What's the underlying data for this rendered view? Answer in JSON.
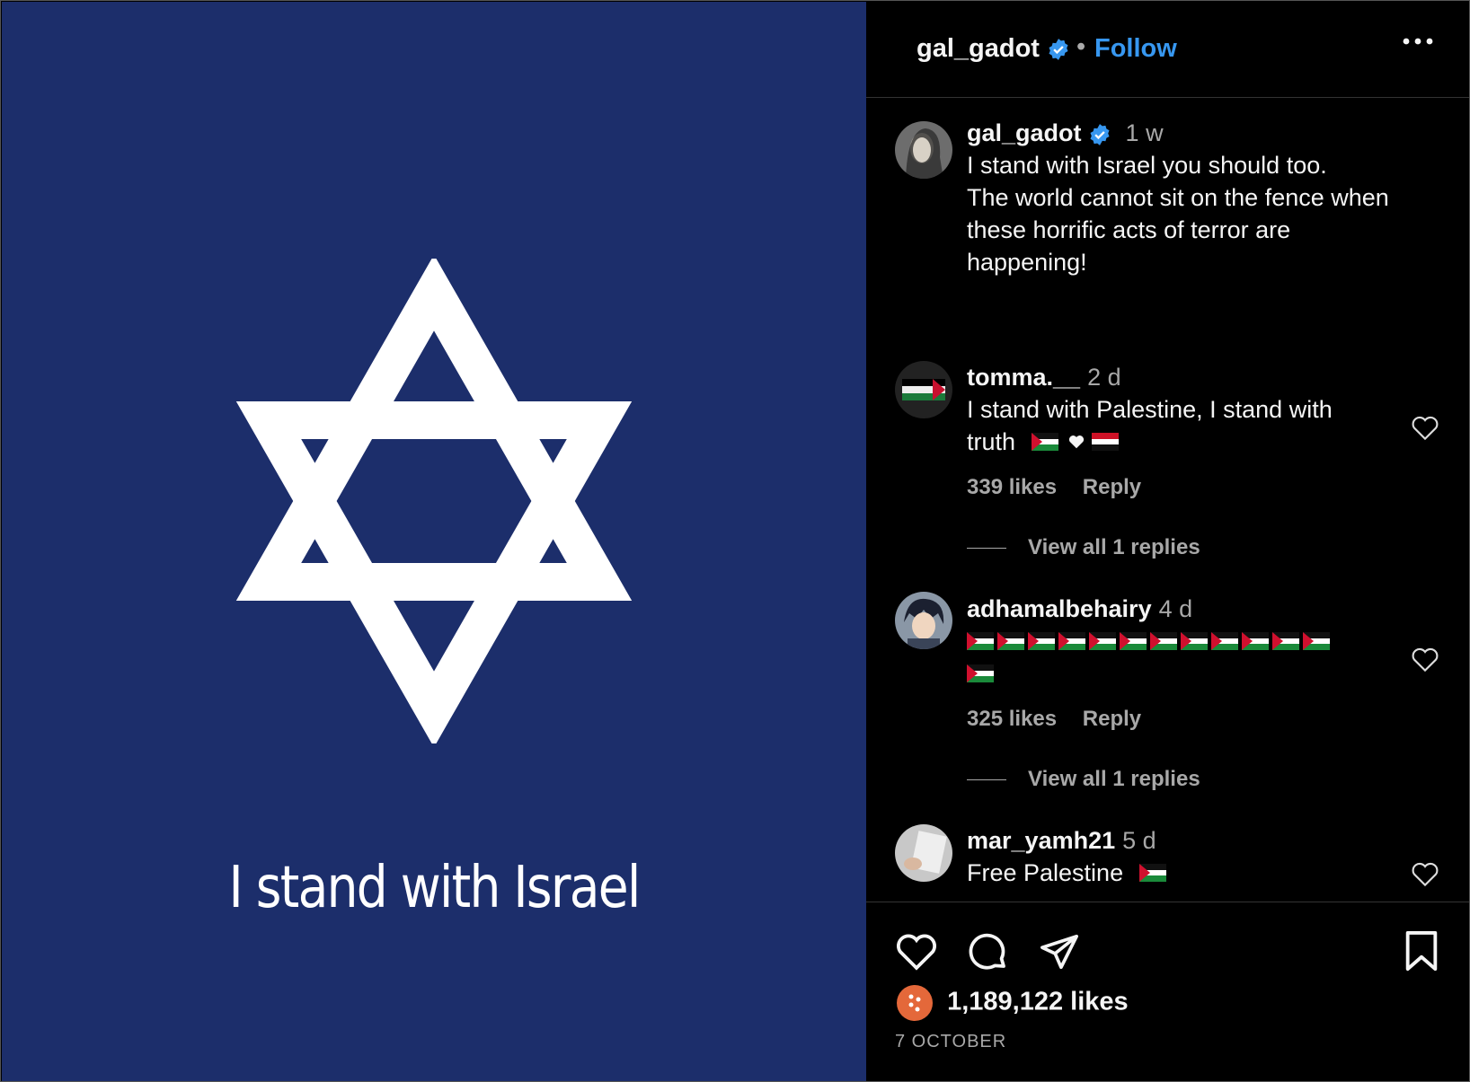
{
  "post": {
    "image_caption": "I stand with Israel",
    "username": "gal_gadot",
    "follow_label": "Follow",
    "caption_time": "1 w",
    "caption_lines": [
      "I stand with Israel you should too.",
      "The world cannot sit on the fence when",
      "these horrific acts of terror are",
      "happening!"
    ]
  },
  "comments": [
    {
      "username": "tomma.__",
      "time": "2 d",
      "text_line1": "I stand with Palestine, I stand with",
      "text_line2": "truth",
      "likes": "339 likes",
      "reply_label": "Reply",
      "view_replies": "View all 1 replies"
    },
    {
      "username": "adhamalbehairy",
      "time": "4 d",
      "flags_count": 13,
      "likes": "325 likes",
      "reply_label": "Reply",
      "view_replies": "View all 1 replies"
    },
    {
      "username": "mar_yamh21",
      "time": "5 d",
      "text": "Free Palestine"
    }
  ],
  "footer": {
    "likes": "1,189,122 likes",
    "date": "7 OCTOBER"
  },
  "colors": {
    "image_bg": "#1c2e6b",
    "accent": "#3797f0",
    "muted": "#a8a8a8"
  },
  "icons": [
    "verified-badge-icon",
    "more-options-icon",
    "heart-icon",
    "comment-icon",
    "share-icon",
    "bookmark-icon",
    "palestine-flag-icon",
    "yemen-flag-icon"
  ]
}
